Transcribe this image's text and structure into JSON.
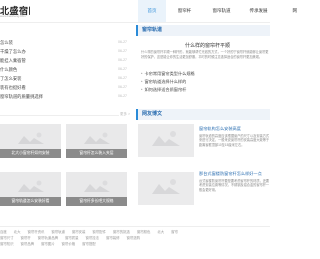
{
  "header": {
    "site_name": "北盛宿网",
    "site_url": "www.beisheng.com",
    "nav": [
      {
        "label": "首页",
        "active": true
      },
      {
        "label": "窗帘杆",
        "active": false
      },
      {
        "label": "窗帘轨道",
        "active": false
      },
      {
        "label": "传承发展",
        "active": false
      },
      {
        "label": "网",
        "active": false
      }
    ]
  },
  "left_list": {
    "items": [
      {
        "title": "怎么装",
        "date": "06-27"
      },
      {
        "title": "干燥了怎么办",
        "date": "06-27"
      },
      {
        "title": "能挂入乘宿管",
        "date": "06-27"
      },
      {
        "title": "什么颜色",
        "date": "06-27"
      },
      {
        "title": "了怎么安装",
        "date": "06-27"
      },
      {
        "title": "装有也挺好看",
        "date": "06-27"
      },
      {
        "title": "窗帘轨道的质量挑选择",
        "date": "06-27"
      }
    ],
    "more": "更多 >"
  },
  "gallery": [
    {
      "caption": "北大小窗帘杆如何安装"
    },
    {
      "caption": "窗帘杆怎么装入夹层"
    },
    {
      "caption": "窗帘轨道怎么安装好看"
    },
    {
      "caption": "窗帘杆多长吧大规格"
    }
  ],
  "news": {
    "heading": "窗帘轨道",
    "feature_title": "什么样的窗帘杆平顺",
    "feature_desc": "什么样的窗帘杆平顺一种杆形，就能够帮忙光线的方式，一个好的宁窗帘杆就能够让窗帘更好的保护，这是能让你的生活更加舒服，平时的时候注意选择适合的窗帘杆更加美观。",
    "questions": [
      "卡帘常用窗帘类型什么规格",
      "窗帘轨道选择什么样的",
      "如何选择适合质窗帘杆"
    ]
  },
  "blog": {
    "heading": "网友博文",
    "posts": [
      {
        "title": "窗帘轨构怎么安装高度",
        "desc": "窗帘轨道的高度应该根据窗户的尺寸以及安装方式来进行决定，一般来说窗帘杆的安装高度大致等于距离窗框顶部10至15厘米左右。"
      },
      {
        "title": "那台式窗楼防窗帘杆怎么样好一点",
        "desc": "台式窗楼防窗帘杆要是要考虑窗帘杆的材质，还要考虑安装位置等情况，不锈钢及铝合金的窗帘杆一般会更好用。"
      }
    ]
  },
  "footer": {
    "row1": [
      "百度",
      "北大",
      "窗帘杆资讯",
      "窗帘轨道",
      "窗帘安装",
      "窗帘配件",
      "窗帘的挑选",
      "窗帘颜色",
      "北大",
      "窗帘"
    ],
    "row2": [
      "窗帘尺寸",
      "窗帘杆",
      "窗帘轨道品牌",
      "窗帘质量",
      "窗帘挂法",
      "窗帘装修",
      "窗帘选购"
    ],
    "row3": [
      "窗帘知识",
      "窗帘品牌",
      "窗帘图片",
      "窗帘价格",
      "窗帘搭配"
    ]
  }
}
